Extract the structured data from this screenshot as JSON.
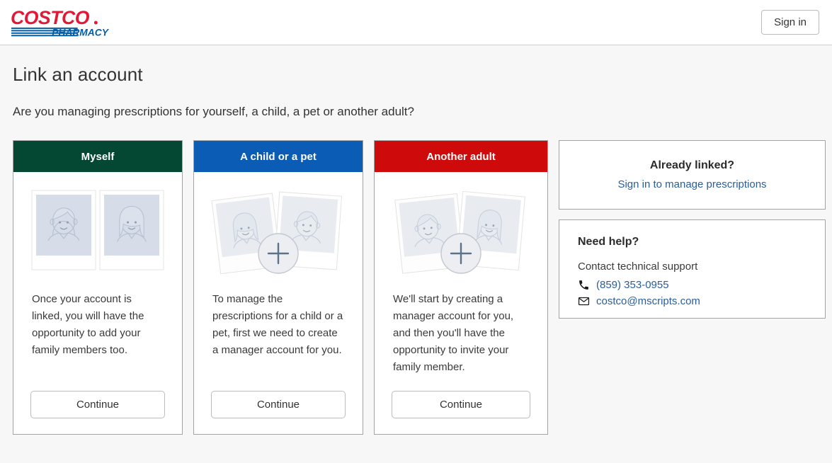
{
  "header": {
    "logo_name": "costco-pharmacy-logo",
    "logo_primary_text": "COSTCO",
    "logo_secondary_text": "PHARMACY",
    "signin_label": "Sign in"
  },
  "page": {
    "title": "Link an account",
    "subtitle": "Are you managing prescriptions for yourself, a child, a pet or another adult?"
  },
  "colors": {
    "page_background": "#f7f7f7",
    "card_myself_header": "#044833",
    "card_child_header": "#0b5cb5",
    "card_adult_header": "#cf0a0a",
    "link_blue": "#2b5d9b",
    "logo_red": "#e31837",
    "logo_blue": "#005daa",
    "border_gray": "#a3a3a3"
  },
  "cards": [
    {
      "id": "myself",
      "header_label": "Myself",
      "header_color": "#044833",
      "art": "two-upright-polaroids",
      "body_text": "Once your account is linked, you will have the opportunity to add your family members too.",
      "button_label": "Continue"
    },
    {
      "id": "child-or-pet",
      "header_label": "A child or a pet",
      "header_color": "#0b5cb5",
      "art": "two-tilted-polaroids-with-plus",
      "body_text": "To manage the prescriptions for a child or a pet, first we need to create a manager account for you.",
      "button_label": "Continue"
    },
    {
      "id": "another-adult",
      "header_label": "Another adult",
      "header_color": "#cf0a0a",
      "art": "two-tilted-polaroids-with-plus",
      "body_text": "We'll start by creating a manager account for you, and then you'll have the opportunity to invite your family member.",
      "button_label": "Continue"
    }
  ],
  "sidebar": {
    "already_linked": {
      "title": "Already linked?",
      "link_label": "Sign in to manage prescriptions"
    },
    "need_help": {
      "title": "Need help?",
      "contact_line": "Contact technical support",
      "phone": "(859) 353-0955",
      "email": "costco@mscripts.com",
      "phone_icon": "phone-icon",
      "email_icon": "envelope-icon"
    }
  }
}
